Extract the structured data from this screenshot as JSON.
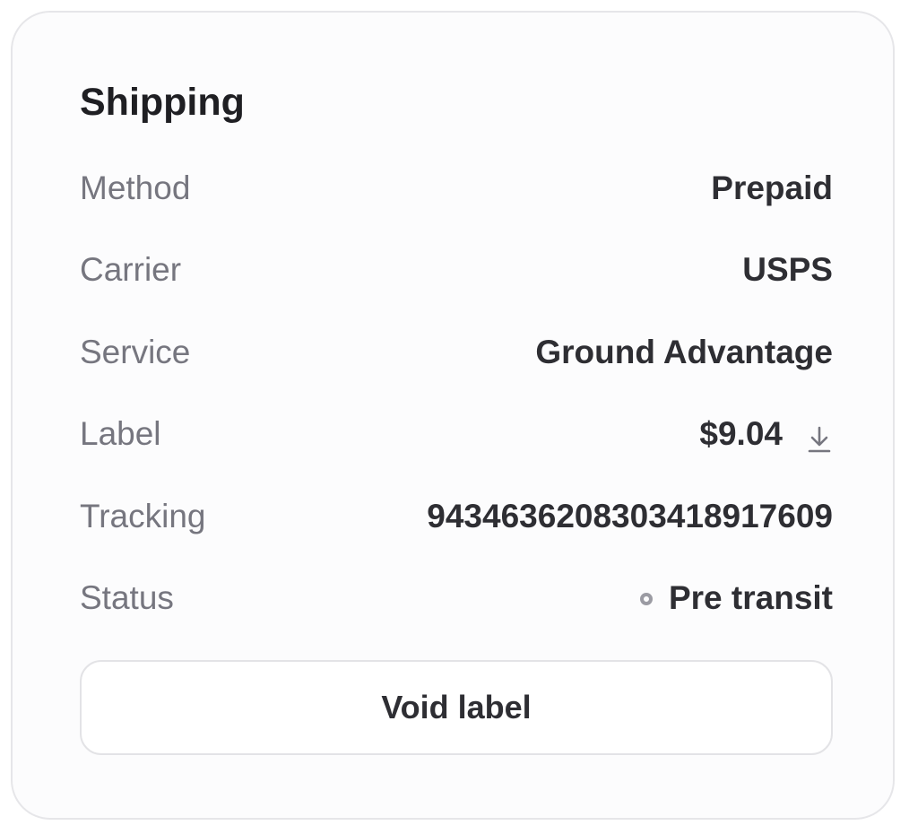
{
  "card": {
    "title": "Shipping",
    "rows": [
      {
        "label": "Method",
        "value": "Prepaid"
      },
      {
        "label": "Carrier",
        "value": "USPS"
      },
      {
        "label": "Service",
        "value": "Ground Advantage"
      },
      {
        "label": "Label",
        "value": "$9.04",
        "icon": "download-icon"
      },
      {
        "label": "Tracking",
        "value": "9434636208303418917609"
      },
      {
        "label": "Status",
        "value": "Pre transit",
        "icon": "status-dot-icon"
      }
    ],
    "void_button_label": "Void label"
  },
  "colors": {
    "title": "#1f1f23",
    "label": "#76767f",
    "value": "#2e2e33",
    "status_dot": "#9b9ba3",
    "card_border": "#e6e6e9",
    "card_background": "#fcfcfd"
  }
}
